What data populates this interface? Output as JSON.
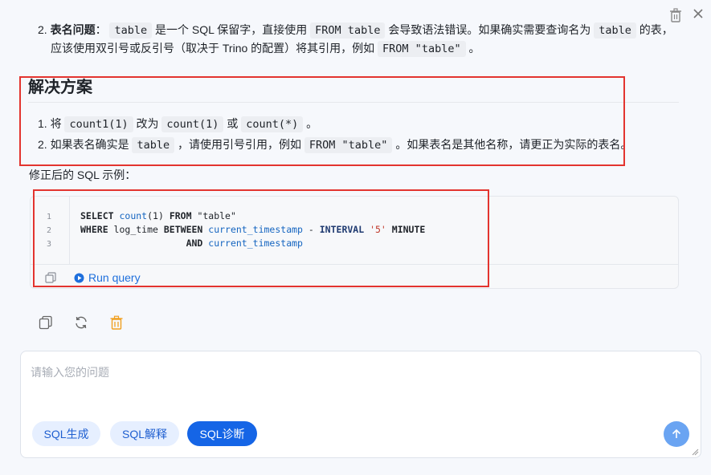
{
  "problem_item": {
    "number": "2.",
    "bold": "表名问题",
    "t1": "：",
    "c1": "table",
    "t2": " 是一个 SQL 保留字，直接使用 ",
    "c2": "FROM table",
    "t3": " 会导致语法错误。如果确实需要查询名为 ",
    "c3": "table",
    "t4": " 的表，",
    "line2a": "应该使用双引号或反引号（取决于 Trino 的配置）将其引用，例如 ",
    "c4": "FROM \"table\"",
    "line2b": " 。"
  },
  "solution": {
    "heading": "解决方案",
    "item1": {
      "number": "1.",
      "a": "将 ",
      "c1": "count1(1)",
      "b": " 改为 ",
      "c2": "count(1)",
      "c": " 或 ",
      "c3": "count(*)",
      "d": " 。"
    },
    "item2": {
      "number": "2.",
      "a": "如果表名确实是 ",
      "c1": "table",
      "b": " ，请使用引号引用，例如 ",
      "c2": "FROM \"table\"",
      "c": " 。如果表名是其他名称，请更正为实际的表名。"
    }
  },
  "caption": "修正后的 SQL 示例：",
  "code": {
    "line_numbers": [
      "1",
      "2",
      "3"
    ],
    "l1": {
      "k1": "SELECT",
      "f1": "count",
      "p1": "(1)",
      "k2": " FROM",
      "s1": " \"table\""
    },
    "l2": {
      "k1": "WHERE",
      "t1": " log_time ",
      "k2": "BETWEEN",
      "f1": " current_timestamp",
      "t2": " - ",
      "k3": "INTERVAL",
      "s1": " '5'",
      "k4": " MINUTE"
    },
    "l3": {
      "pad": "                   ",
      "k1": "AND",
      "f1": " current_timestamp"
    }
  },
  "run_label": "Run query",
  "input": {
    "placeholder": "请输入您的问题"
  },
  "chips": [
    "SQL生成",
    "SQL解释",
    "SQL诊断"
  ],
  "icons": [
    "trash-icon",
    "close-icon",
    "copy-icon",
    "refresh-icon",
    "delete-icon",
    "play-icon",
    "send-arrow-icon"
  ],
  "colors": {
    "accent": "#1565e6",
    "highlight_box": "#e3342f",
    "delete_orange": "#f0a020"
  }
}
